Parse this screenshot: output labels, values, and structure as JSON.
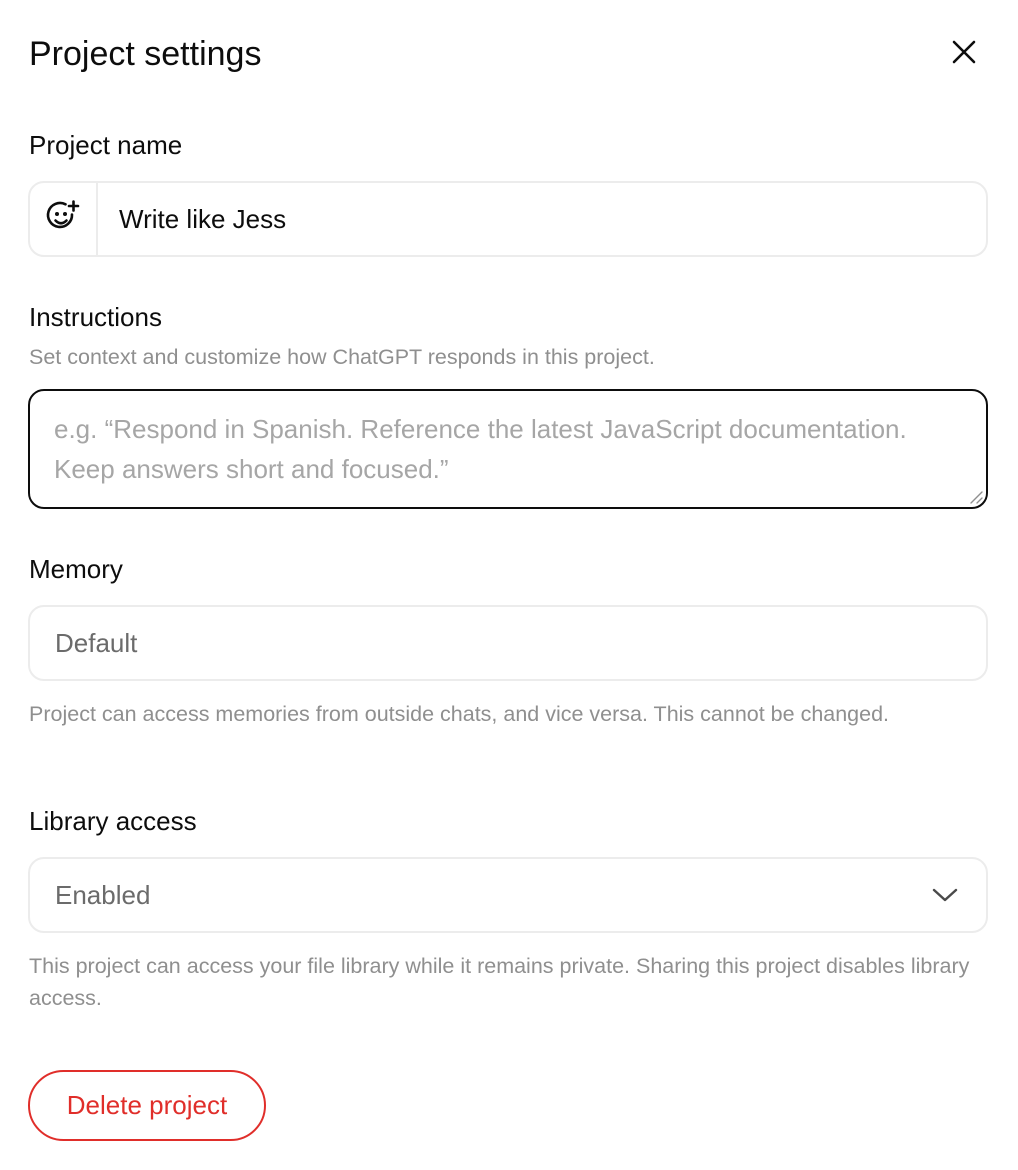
{
  "dialog": {
    "title": "Project settings",
    "close_icon": "close-icon"
  },
  "project_name": {
    "label": "Project name",
    "value": "Write like Jess",
    "emoji_icon": "add-emoji-icon"
  },
  "instructions": {
    "label": "Instructions",
    "hint": "Set context and customize how ChatGPT responds in this project.",
    "placeholder": "e.g. “Respond in Spanish. Reference the latest JavaScript documentation. Keep answers short and focused.”",
    "value": ""
  },
  "memory": {
    "label": "Memory",
    "value": "Default",
    "hint": "Project can access memories from outside chats, and vice versa. This cannot be changed."
  },
  "library_access": {
    "label": "Library access",
    "selected": "Enabled",
    "hint": "This project can access your file library while it remains private. Sharing this project disables library access.",
    "chevron_icon": "chevron-down-icon"
  },
  "actions": {
    "delete_label": "Delete project"
  },
  "colors": {
    "danger": "#e02e2a",
    "text": "#0d0d0d",
    "muted": "#8f8f8f",
    "border": "#ececec"
  }
}
